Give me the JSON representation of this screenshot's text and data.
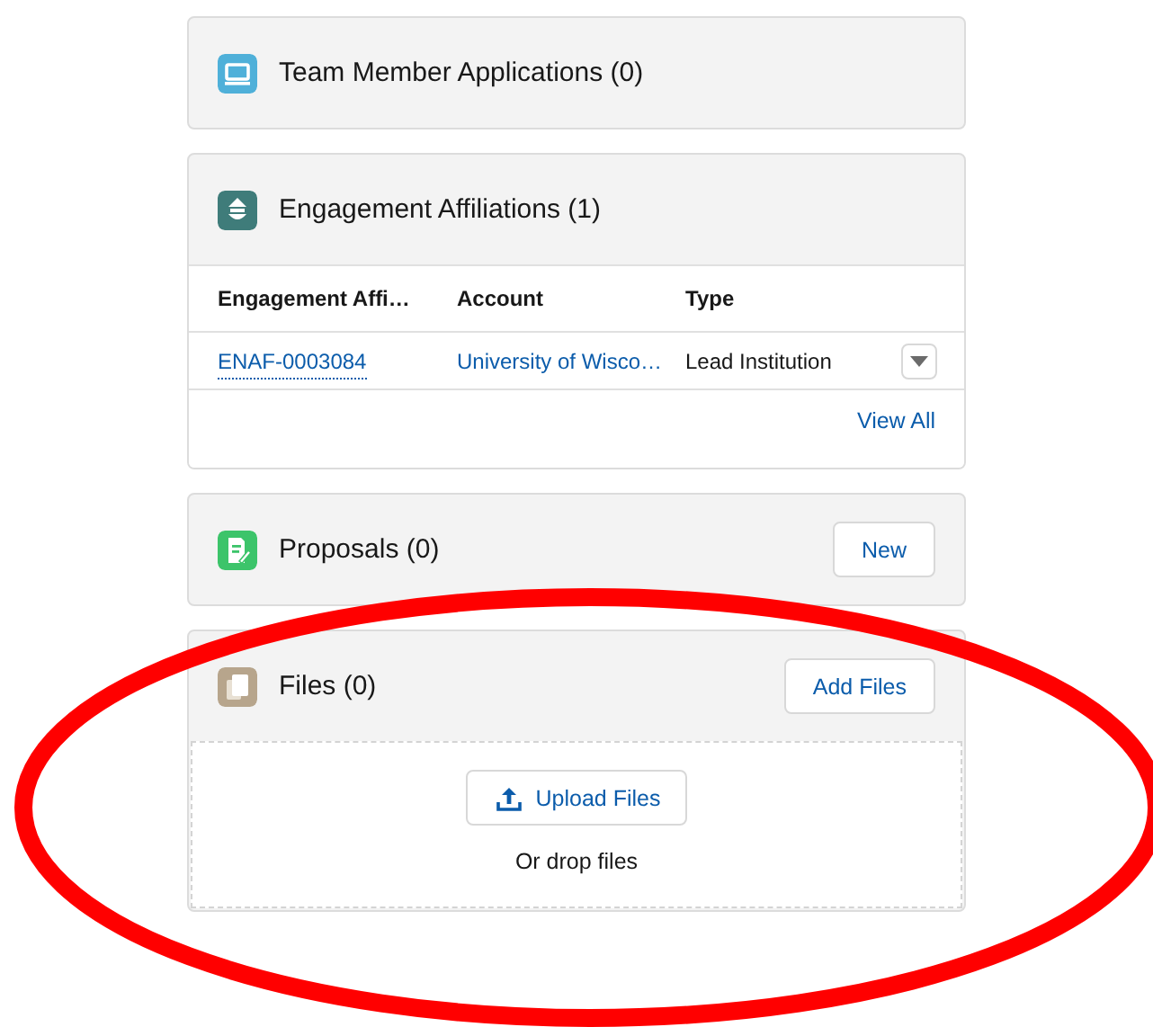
{
  "cards": [
    {
      "kind": "plain",
      "title": "Team Member Applications (0)"
    },
    {
      "kind": "table",
      "title": "Engagement Affiliations (1)",
      "table": {
        "columns": [
          "Engagement Affi…",
          "Account",
          "Type"
        ],
        "rows": [
          {
            "cells": [
              "ENAF-0003084",
              "University of Wisco…",
              "Lead Institution"
            ]
          }
        ]
      },
      "footer_link": "View All"
    },
    {
      "kind": "plain",
      "title": "Proposals (0)",
      "button": "New"
    },
    {
      "kind": "files",
      "title": "Files (0)",
      "button": "Add Files",
      "upload_button": "Upload Files",
      "drop_hint": "Or drop files"
    }
  ]
}
